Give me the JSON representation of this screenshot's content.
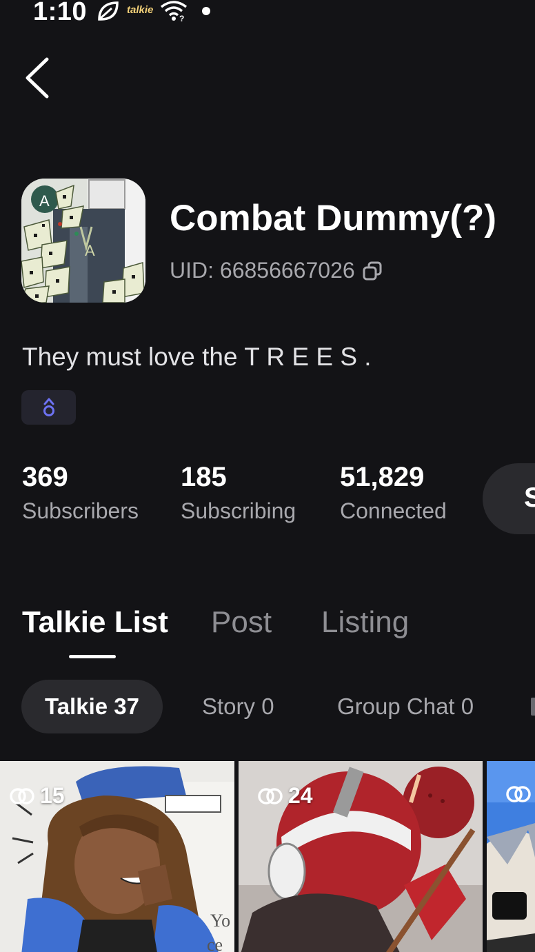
{
  "status_bar": {
    "time": "1:10",
    "app_badge": "talkie"
  },
  "profile": {
    "name": "Combat Dummy(?)",
    "uid": "UID: 66856667026",
    "bio": "They must love the T R E E S ."
  },
  "stats": [
    {
      "value": "369",
      "label": "Subscribers"
    },
    {
      "value": "185",
      "label": "Subscribing"
    },
    {
      "value": "51,829",
      "label": "Connected"
    }
  ],
  "subscribe_button": {
    "label": "S"
  },
  "main_tabs": [
    {
      "label": "Talkie List",
      "active": true
    },
    {
      "label": "Post",
      "active": false
    },
    {
      "label": "Listing",
      "active": false
    }
  ],
  "filter_chips": [
    {
      "label": "Talkie 37",
      "active": true
    },
    {
      "label": "Story 0",
      "active": false
    },
    {
      "label": "Group Chat 0",
      "active": false
    }
  ],
  "cards": [
    {
      "count": "15"
    },
    {
      "count": "24"
    },
    {
      "count": ""
    }
  ],
  "colors": {
    "background": "#131316",
    "surface": "#2a2a2e",
    "muted_text": "#a8a8ad",
    "badge_chip": "#24242e",
    "badge_icon": "#6d72f2"
  },
  "icons": [
    "leaf-icon",
    "wifi-icon",
    "back-arrow-icon",
    "copy-icon",
    "level-badge-icon",
    "connection-icon"
  ]
}
